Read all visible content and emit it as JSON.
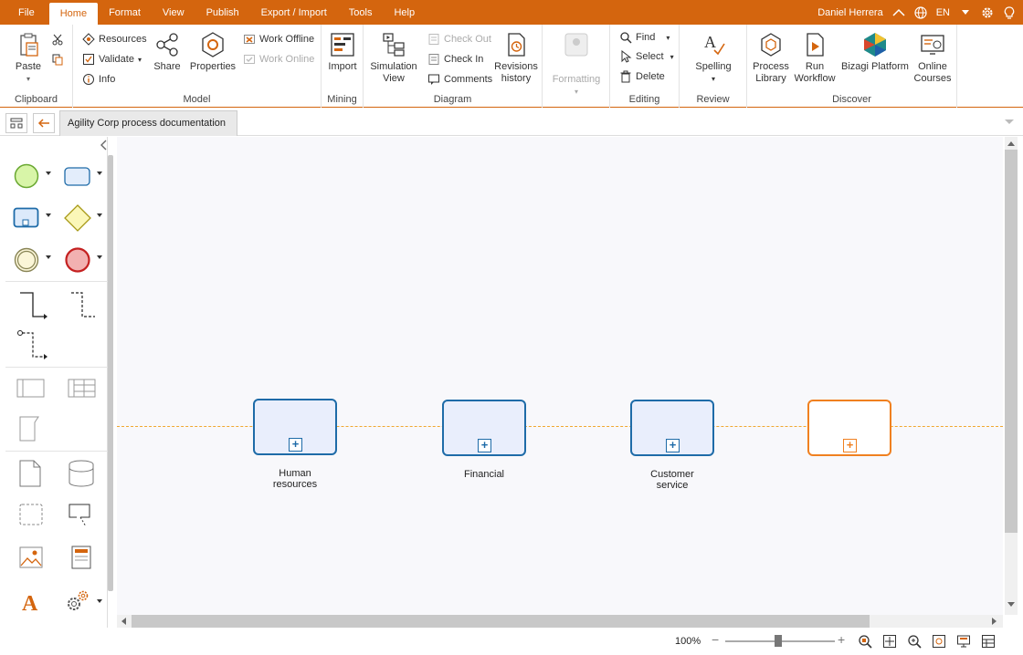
{
  "menu": {
    "file": "File",
    "home": "Home",
    "format": "Format",
    "view": "View",
    "publish": "Publish",
    "export_import": "Export / Import",
    "tools": "Tools",
    "help": "Help",
    "user": "Daniel Herrera",
    "language": "EN"
  },
  "ribbon": {
    "clipboard": {
      "paste": "Paste",
      "label": "Clipboard"
    },
    "model": {
      "resources": "Resources",
      "validate": "Validate",
      "info": "Info",
      "share": "Share",
      "properties": "Properties",
      "work_offline": "Work Offline",
      "work_online": "Work Online",
      "label": "Model"
    },
    "mining": {
      "import": "Import",
      "label": "Mining"
    },
    "diagram": {
      "simulation_view_1": "Simulation",
      "simulation_view_2": "View",
      "check_out": "Check Out",
      "check_in": "Check In",
      "comments": "Comments",
      "revisions_1": "Revisions",
      "revisions_2": "history",
      "label": "Diagram"
    },
    "formatting": {
      "label": "Formatting"
    },
    "editing": {
      "find": "Find",
      "select": "Select",
      "delete": "Delete",
      "label": "Editing"
    },
    "review": {
      "spelling": "Spelling",
      "label": "Review"
    },
    "discover": {
      "process_library_1": "Process",
      "process_library_2": "Library",
      "run_workflow_1": "Run",
      "run_workflow_2": "Workflow",
      "bizagi_platform": "Bizagi Platform",
      "online_courses_1": "Online",
      "online_courses_2": "Courses",
      "label": "Discover"
    }
  },
  "tab": {
    "title": "Agility Corp process documentation"
  },
  "canvas": {
    "subprocesses": [
      {
        "line1": "Human",
        "line2": "resources"
      },
      {
        "line1": "Financial",
        "line2": ""
      },
      {
        "line1": "Customer",
        "line2": "service"
      },
      {
        "line1": "",
        "line2": ""
      }
    ]
  },
  "status": {
    "zoom": "100%"
  },
  "colors": {
    "accent": "#d4650e",
    "task_border": "#1e6ba8",
    "selection": "#f08020"
  }
}
